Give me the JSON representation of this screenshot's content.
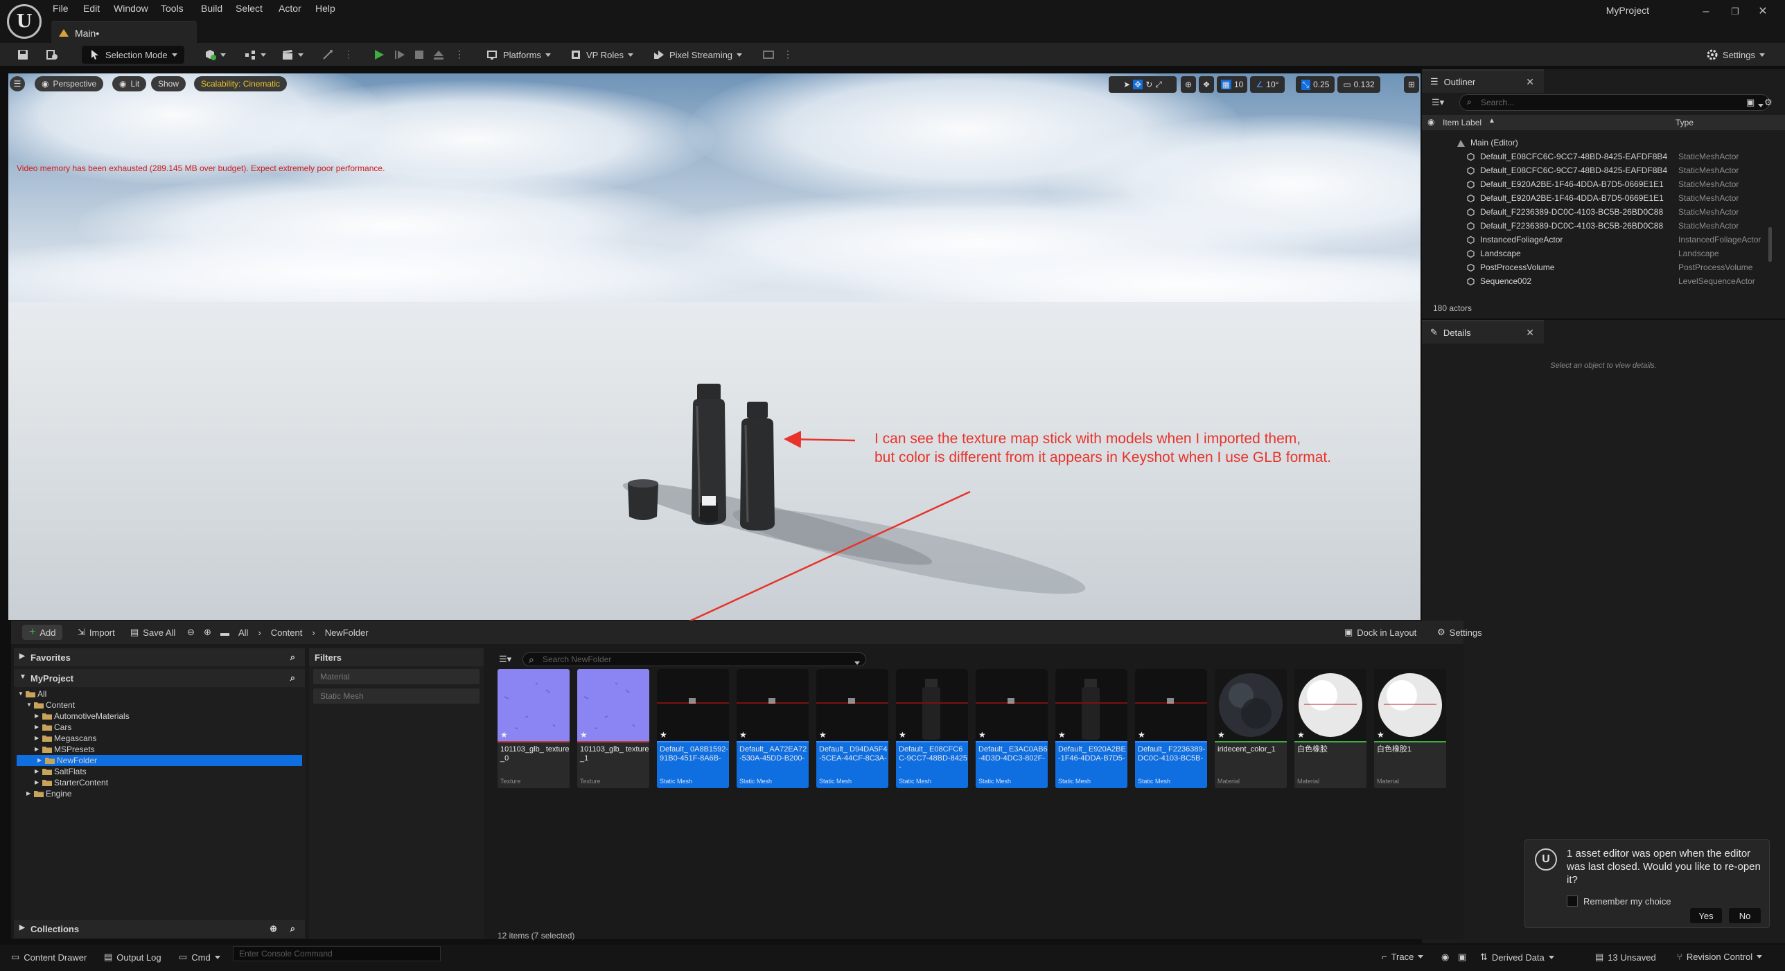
{
  "app": {
    "project": "MyProject",
    "menu": [
      "File",
      "Edit",
      "Window",
      "Tools",
      "Build",
      "Select",
      "Actor",
      "Help"
    ],
    "tab": "Main•"
  },
  "toolbar": {
    "selection_mode": "Selection Mode",
    "platforms": "Platforms",
    "vp_roles": "VP Roles",
    "pixel_streaming": "Pixel Streaming",
    "settings": "Settings"
  },
  "viewport": {
    "perspective": "Perspective",
    "lit": "Lit",
    "show": "Show",
    "scalability": "Scalability: Cinematic",
    "warning": "Video memory has been exhausted (289.145 MB over budget). Expect extremely poor performance.",
    "annotation_line1": "I can see the texture map stick with models when I imported them,",
    "annotation_line2": "but color is different from it appears in Keyshot when I use GLB format.",
    "grid_snap": "10",
    "rot_snap": "10°",
    "scale_snap": "0.25",
    "camera_speed": "0.132"
  },
  "outliner": {
    "title": "Outliner",
    "search_placeholder": "Search...",
    "col_label": "Item Label",
    "col_type": "Type",
    "root": "Main (Editor)",
    "rows": [
      {
        "label": "Default_E08CFC6C-9CC7-48BD-8425-EAFDF8B4",
        "type": "StaticMeshActor"
      },
      {
        "label": "Default_E08CFC6C-9CC7-48BD-8425-EAFDF8B4",
        "type": "StaticMeshActor"
      },
      {
        "label": "Default_E920A2BE-1F46-4DDA-B7D5-0669E1E1",
        "type": "StaticMeshActor"
      },
      {
        "label": "Default_E920A2BE-1F46-4DDA-B7D5-0669E1E1",
        "type": "StaticMeshActor"
      },
      {
        "label": "Default_F2236389-DC0C-4103-BC5B-26BD0C88",
        "type": "StaticMeshActor"
      },
      {
        "label": "Default_F2236389-DC0C-4103-BC5B-26BD0C88",
        "type": "StaticMeshActor"
      },
      {
        "label": "InstancedFoliageActor",
        "type": "InstancedFoliageActor"
      },
      {
        "label": "Landscape",
        "type": "Landscape"
      },
      {
        "label": "PostProcessVolume",
        "type": "PostProcessVolume"
      },
      {
        "label": "Sequence002",
        "type": "LevelSequenceActor"
      }
    ],
    "count": "180 actors"
  },
  "details": {
    "title": "Details",
    "empty": "Select an object to view details."
  },
  "content_browser": {
    "add": "Add",
    "import": "Import",
    "save_all": "Save All",
    "crumbs": [
      "All",
      "Content",
      "NewFolder"
    ],
    "dock": "Dock in Layout",
    "settings": "Settings",
    "favorites": "Favorites",
    "myproject": "MyProject",
    "tree": [
      {
        "label": "All",
        "depth": 0,
        "open": true
      },
      {
        "label": "Content",
        "depth": 1,
        "open": true
      },
      {
        "label": "AutomotiveMaterials",
        "depth": 2
      },
      {
        "label": "Cars",
        "depth": 2
      },
      {
        "label": "Megascans",
        "depth": 2
      },
      {
        "label": "MSPresets",
        "depth": 2
      },
      {
        "label": "NewFolder",
        "depth": 2,
        "selected": true
      },
      {
        "label": "SaltFlats",
        "depth": 2
      },
      {
        "label": "StarterContent",
        "depth": 2
      },
      {
        "label": "Engine",
        "depth": 1
      }
    ],
    "collections": "Collections",
    "filters_title": "Filters",
    "filters": [
      "Material",
      "Static Mesh"
    ],
    "search_placeholder": "Search NewFolder",
    "assets": [
      {
        "name": "101103_glb_ texture_0",
        "kind": "Texture",
        "selected": false,
        "thumb": "normal"
      },
      {
        "name": "101103_glb_ texture_1",
        "kind": "Texture",
        "selected": false,
        "thumb": "normal"
      },
      {
        "name": "Default_ 0A8B1592-91B0-451F-8A6B-",
        "kind": "Static Mesh",
        "selected": true,
        "thumb": "mesh"
      },
      {
        "name": "Default_ AA72EA72-530A-45DD-B200-",
        "kind": "Static Mesh",
        "selected": true,
        "thumb": "mesh"
      },
      {
        "name": "Default_ D94DA5F4-5CEA-44CF-8C3A-",
        "kind": "Static Mesh",
        "selected": true,
        "thumb": "mesh"
      },
      {
        "name": "Default_ E08CFC6C-9CC7-48BD-8425-",
        "kind": "Static Mesh",
        "selected": true,
        "thumb": "bottle"
      },
      {
        "name": "Default_ E3AC0AB6-4D3D-4DC3-802F-",
        "kind": "Static Mesh",
        "selected": true,
        "thumb": "mesh"
      },
      {
        "name": "Default_ E920A2BE-1F46-4DDA-B7D5-",
        "kind": "Static Mesh",
        "selected": true,
        "thumb": "bottle"
      },
      {
        "name": "Default_ F2236389-DC0C-4103-BC5B-",
        "kind": "Static Mesh",
        "selected": true,
        "thumb": "mesh"
      },
      {
        "name": "iridecent_color_1",
        "kind": "Material",
        "selected": false,
        "thumb": "dark-sphere"
      },
      {
        "name": "白色橡胶",
        "kind": "Material",
        "selected": false,
        "thumb": "white-sphere"
      },
      {
        "name": "白色橡胶1",
        "kind": "Material",
        "selected": false,
        "thumb": "white-sphere"
      }
    ],
    "count": "12 items (7 selected)"
  },
  "notification": {
    "message": "1 asset editor was open when the editor was last closed. Would you like to re-open it?",
    "remember": "Remember my choice",
    "yes": "Yes",
    "no": "No"
  },
  "statusbar": {
    "content_drawer": "Content Drawer",
    "output_log": "Output Log",
    "cmd": "Cmd",
    "console_placeholder": "Enter Console Command",
    "trace": "Trace",
    "derived_data": "Derived Data",
    "unsaved": "13 Unsaved",
    "revision": "Revision Control"
  },
  "colors": {
    "accent": "#0f6ee0",
    "warning": "#d11b1b",
    "annotation": "#e8332b",
    "play": "#3fae3f"
  }
}
